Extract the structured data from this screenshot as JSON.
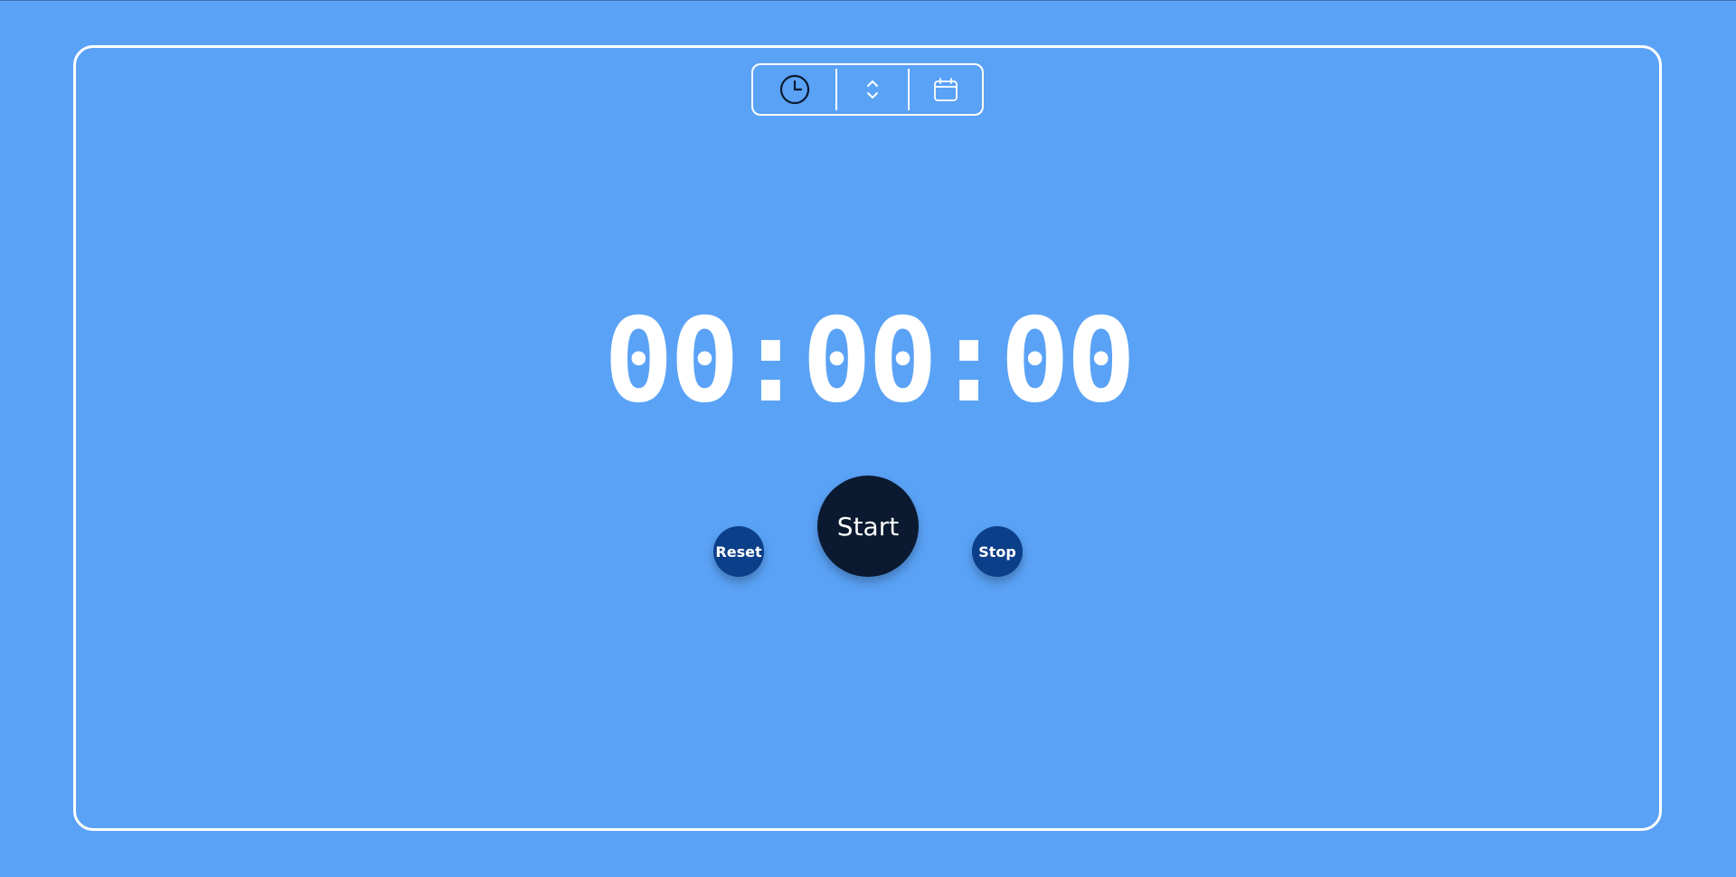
{
  "mode_switcher": {
    "items": [
      {
        "icon": "clock-icon",
        "active": true
      },
      {
        "icon": "chevron-up-down-icon",
        "active": false
      },
      {
        "icon": "calendar-icon",
        "active": false
      }
    ]
  },
  "timer": {
    "display": "00:00:00"
  },
  "controls": {
    "reset_label": "Reset",
    "start_label": "Start",
    "stop_label": "Stop"
  },
  "colors": {
    "background": "#5aa2f6",
    "frame_border": "#ffffff",
    "start_button": "#0b1a30",
    "secondary_button": "#0c3f89",
    "text": "#ffffff"
  }
}
